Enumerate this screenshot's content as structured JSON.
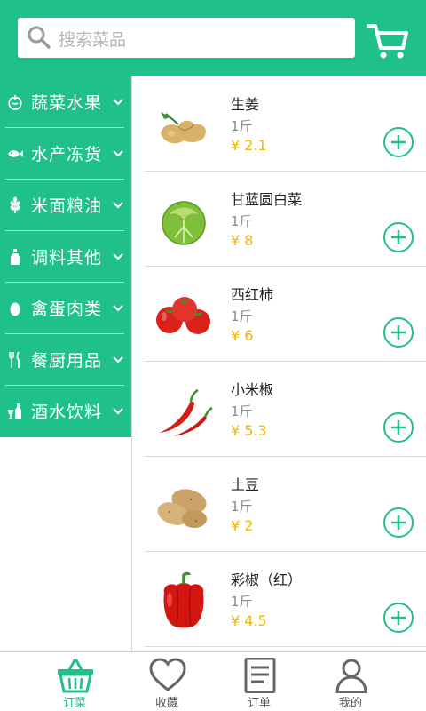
{
  "header": {
    "search_placeholder": "搜索菜品",
    "search_icon": "search-icon",
    "cart_icon": "shopping-cart-icon",
    "brand_color": "#20c08b"
  },
  "sidebar": {
    "categories": [
      {
        "label": "蔬菜水果",
        "icon": "vegetable-icon"
      },
      {
        "label": "水产冻货",
        "icon": "fish-icon"
      },
      {
        "label": "米面粮油",
        "icon": "grain-icon"
      },
      {
        "label": "调料其他",
        "icon": "bottle-icon"
      },
      {
        "label": "禽蛋肉类",
        "icon": "egg-icon"
      },
      {
        "label": "餐厨用品",
        "icon": "utensils-icon"
      },
      {
        "label": "酒水饮料",
        "icon": "drinks-icon"
      }
    ]
  },
  "products": [
    {
      "name": "生姜",
      "unit": "1斤",
      "price": "¥ 2.1"
    },
    {
      "name": "甘蓝圆白菜",
      "unit": "1斤",
      "price": "¥ 8"
    },
    {
      "name": "西红柿",
      "unit": "1斤",
      "price": "¥ 6"
    },
    {
      "name": "小米椒",
      "unit": "1斤",
      "price": "¥ 5.3"
    },
    {
      "name": "土豆",
      "unit": "1斤",
      "price": "¥ 2"
    },
    {
      "name": "彩椒（红）",
      "unit": "1斤",
      "price": "¥ 4.5"
    }
  ],
  "price_color": "#f2b705",
  "bottom_nav": [
    {
      "label": "订菜",
      "icon": "basket-icon",
      "active": true
    },
    {
      "label": "收藏",
      "icon": "heart-icon",
      "active": false
    },
    {
      "label": "订单",
      "icon": "document-icon",
      "active": false
    },
    {
      "label": "我的",
      "icon": "user-icon",
      "active": false
    }
  ]
}
